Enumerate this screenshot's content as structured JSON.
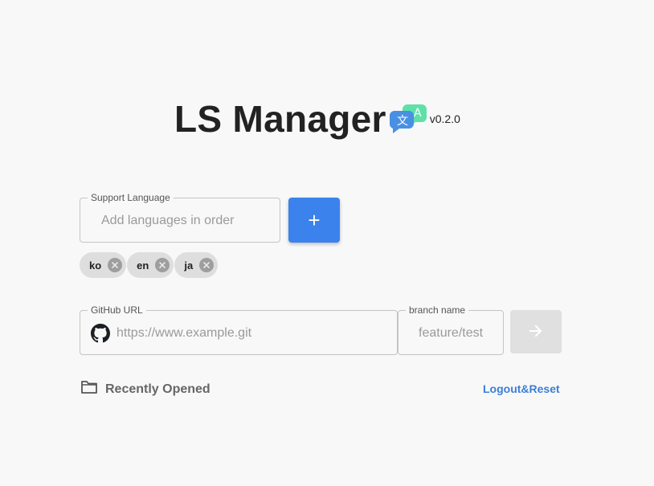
{
  "header": {
    "title": "LS Manager",
    "version": "v0.2.0",
    "logo_icon": "translate-icon",
    "logo_glyph_left": "文",
    "logo_glyph_right": "A"
  },
  "language_form": {
    "label": "Support Language",
    "placeholder": "Add languages in order",
    "value": "",
    "add_button_label": "+",
    "chips": [
      {
        "label": "ko"
      },
      {
        "label": "en"
      },
      {
        "label": "ja"
      }
    ]
  },
  "repo_form": {
    "github_label": "GitHub URL",
    "github_placeholder": "https://www.example.git",
    "github_value": "",
    "github_icon": "github-icon",
    "branch_label": "branch name",
    "branch_placeholder": "feature/test",
    "branch_value": "",
    "submit_icon": "arrow-right-icon"
  },
  "footer": {
    "recent_label": "Recently Opened",
    "recent_icon": "folder-icon",
    "logout_label": "Logout&Reset"
  },
  "colors": {
    "background": "#f8f8f8",
    "primary": "#3b82ec",
    "link": "#3b7fd6",
    "chip": "#dedede",
    "disabled_button": "#e0e0e0",
    "logo_blue": "#4a90e2",
    "logo_green": "#5ee0a8"
  }
}
